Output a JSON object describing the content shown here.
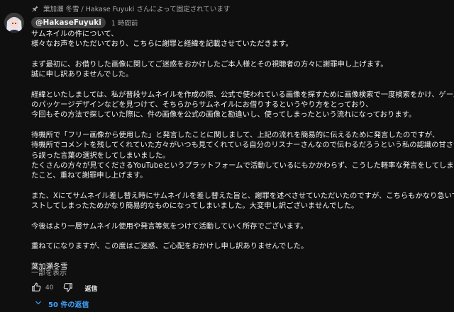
{
  "pinned": {
    "text": "葉加瀬 冬雪 / Hakase Fuyuki さんによって固定されています",
    "icon": "pin-icon"
  },
  "author": {
    "handle": "@HakaseFuyuki",
    "timestamp": "1 時間前",
    "avatar_icon": "avatar"
  },
  "comment": {
    "paragraphs": [
      [
        "サムネイルの件について、",
        "様々なお声をいただいており、こちらに謝罪と経緯を記載させていただきます。"
      ],
      [
        "まず最初に、お借りした画像に関してご迷惑をおかけしたご本人様とその視聴者の方々に謝罪申し上げます。",
        "誠に申し訳ありませんでした。"
      ],
      [
        "経緯といたしましては、私が普段サムネイルを作成の際、公式で使われている画像を探すために画像検索で一度検索をかけ、ゲーム",
        "のパッケージデザインなどを見つけて、そちらからサムネイルにお借りするというやり方をとっており、",
        "今回もその方法で探していた際に、件の画像を公式の画像と勘違いし、使ってしまったという流れになっております。"
      ],
      [
        "待機所で「フリー画像から使用した」と発言したことに関しまして、上記の流れを簡易的に伝えるために発言したのですが、",
        "待機所でコメントを残してくれていた方々がいつも見てくれている自分のリスナーさんなので伝わるだろうという私の認識の甘さか",
        "ら誤った言葉の選択をしてしまいました。",
        "たくさんの方々が見てくださるYouTubeというプラットフォームで活動しているにもかかわらず、こうした軽率な発言をしてしまっ",
        "たこと、重ねて謝罪申し上げます。"
      ],
      [
        "また、Xにてサムネイル差し替え時にサムネイルを差し替えた旨と、謝罪を述べさせていただいたのですが、こちらもかなり急いでポ",
        "ストしてしまったためかなり簡易的なものになってしまいました。大変申し訳ございませんでした。"
      ],
      [
        "今後はより一層サムネイル使用や発言等気をつけて活動していく所存でございます。"
      ],
      [
        "重ねてになりますが、この度はご迷惑、ご心配をおかけし申し訳ありませんでした。"
      ],
      [
        "葉加瀬冬雪"
      ]
    ],
    "show_less": "一部を表示"
  },
  "actions": {
    "like_count": "40",
    "reply_label": "返信",
    "like_icon": "thumbs-up-icon",
    "dislike_icon": "thumbs-down-icon"
  },
  "replies": {
    "label": "50 件の返信",
    "icon": "chevron-down-icon",
    "color": "#3ea6ff"
  },
  "colors": {
    "background": "#0f0f0f",
    "text": "#f1f1f1",
    "secondary": "#aaaaaa",
    "accent": "#3ea6ff",
    "chip": "#3d3d3d"
  }
}
